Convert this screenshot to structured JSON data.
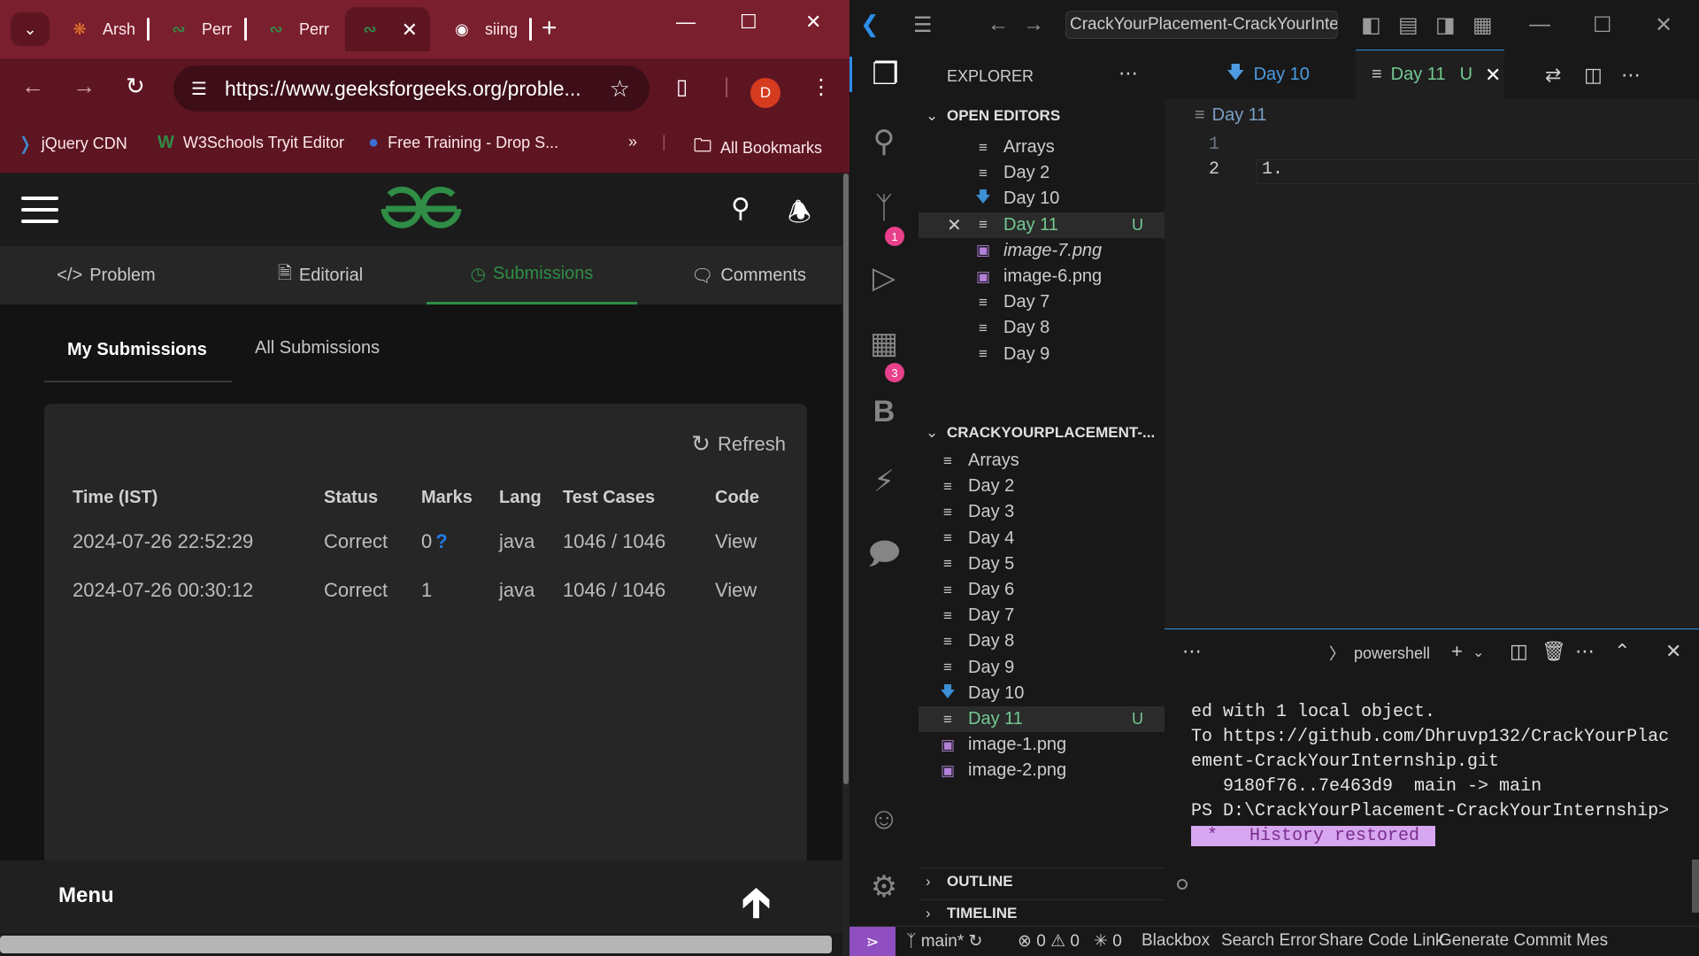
{
  "chrome": {
    "tabs": [
      {
        "label": "Arsh",
        "icon": "gitlab-icon",
        "color": "#e5762b"
      },
      {
        "label": "Perr",
        "icon": "gfg-icon",
        "color": "#2f8d46"
      },
      {
        "label": "Perr",
        "icon": "gfg-icon",
        "color": "#2f8d46"
      },
      {
        "label": "",
        "icon": "gfg-icon",
        "color": "#2f8d46",
        "active": true
      },
      {
        "label": "siing",
        "icon": "github-icon",
        "color": "#ffffff"
      }
    ],
    "url": "https://www.geeksforgeeks.org/proble...",
    "profile_initial": "D",
    "bookmarks": [
      "jQuery CDN",
      "W3Schools Tryit Editor",
      "Free Training - Drop S...",
      "All Bookmarks"
    ],
    "accent": "#7a1f2e"
  },
  "gfg": {
    "tabs": [
      "Problem",
      "Editorial",
      "Submissions",
      "Comments"
    ],
    "active_tab": "Submissions",
    "subtabs": [
      "My Submissions",
      "All Submissions"
    ],
    "refresh_label": "Refresh",
    "columns": [
      "Time (IST)",
      "Status",
      "Marks",
      "Lang",
      "Test Cases",
      "Code"
    ],
    "rows": [
      {
        "time": "2024-07-26 22:52:29",
        "status": "Correct",
        "marks": "0",
        "marks_hint": "?",
        "lang": "java",
        "tests": "1046 / 1046",
        "code": "View"
      },
      {
        "time": "2024-07-26 00:30:12",
        "status": "Correct",
        "marks": "1",
        "marks_hint": "",
        "lang": "java",
        "tests": "1046 / 1046",
        "code": "View"
      }
    ],
    "menu_label": "Menu",
    "brand_color": "#2f8d46"
  },
  "vscode": {
    "command_center": "CrackYourPlacement-CrackYourInternship",
    "badges": {
      "source_control": "1",
      "extensions": "3"
    },
    "explorer_title": "EXPLORER",
    "open_editors_title": "OPEN EDITORS",
    "open_editors": [
      {
        "name": "Arrays",
        "icon": "text-file-icon"
      },
      {
        "name": "Day 2",
        "icon": "text-file-icon"
      },
      {
        "name": "Day 10",
        "icon": "markdown-icon"
      },
      {
        "name": "Day 11",
        "icon": "text-file-icon",
        "status": "U",
        "selected": true
      },
      {
        "name": "image-7.png",
        "icon": "image-file-icon",
        "italic": true
      },
      {
        "name": "image-6.png",
        "icon": "image-file-icon"
      },
      {
        "name": "Day 7",
        "icon": "text-file-icon"
      },
      {
        "name": "Day 8",
        "icon": "text-file-icon"
      },
      {
        "name": "Day 9",
        "icon": "text-file-icon"
      }
    ],
    "folder_title": "CRACKYOURPLACEMENT-...",
    "folder_items": [
      {
        "name": "Arrays",
        "icon": "text-file-icon"
      },
      {
        "name": "Day 2",
        "icon": "text-file-icon"
      },
      {
        "name": "Day 3",
        "icon": "text-file-icon"
      },
      {
        "name": "Day 4",
        "icon": "text-file-icon"
      },
      {
        "name": "Day 5",
        "icon": "text-file-icon"
      },
      {
        "name": "Day 6",
        "icon": "text-file-icon"
      },
      {
        "name": "Day 7",
        "icon": "text-file-icon"
      },
      {
        "name": "Day 8",
        "icon": "text-file-icon"
      },
      {
        "name": "Day 9",
        "icon": "text-file-icon"
      },
      {
        "name": "Day 10",
        "icon": "markdown-icon"
      },
      {
        "name": "Day 11",
        "icon": "text-file-icon",
        "status": "U",
        "selected": true
      },
      {
        "name": "image-1.png",
        "icon": "image-file-icon"
      },
      {
        "name": "image-2.png",
        "icon": "image-file-icon"
      }
    ],
    "outline_title": "OUTLINE",
    "timeline_title": "TIMELINE",
    "editor_tabs": [
      {
        "label": "Day 10",
        "active": false
      },
      {
        "label": "Day 11",
        "active": true,
        "status": "U"
      }
    ],
    "breadcrumb": "Day 11",
    "code_lines": [
      {
        "num": "1",
        "text": ""
      },
      {
        "num": "2",
        "text": "1."
      }
    ],
    "terminal": {
      "shell": "powershell",
      "lines": [
        "ed with 1 local object.",
        "To https://github.com/Dhruvp132/CrackYourPlac",
        "ement-CrackYourInternship.git",
        "   9180f76..7e463d9  main -> main",
        "PS D:\\CrackYourPlacement-CrackYourInternship>"
      ],
      "history_marker": " * ",
      "history": " History restored "
    },
    "status": {
      "branch": "main*",
      "errors": "0",
      "warnings": "0",
      "ports": "0",
      "items": [
        "Blackbox",
        "Search Error",
        "Share Code Link",
        "Generate Commit Mes"
      ]
    }
  }
}
